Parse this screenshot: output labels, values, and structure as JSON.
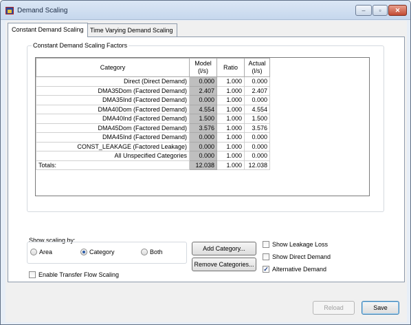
{
  "window": {
    "title": "Demand Scaling",
    "minimize_glyph": "–",
    "restore_glyph": "▫",
    "close_glyph": "✕",
    "icon": "app-icon"
  },
  "tabs": [
    {
      "label": "Constant Demand Scaling",
      "active": true
    },
    {
      "label": "Time Varying Demand Scaling",
      "active": false
    }
  ],
  "factors": {
    "group_title": "Constant Demand Scaling Factors",
    "columns": {
      "category": "Category",
      "model_line1": "Model",
      "model_line2": "(l/s)",
      "ratio": "Ratio",
      "actual_line1": "Actual",
      "actual_line2": "(l/s)"
    },
    "rows": [
      {
        "category": "Direct (Direct Demand)",
        "model": "0.000",
        "ratio": "1.000",
        "actual": "0.000"
      },
      {
        "category": "DMA35Dom (Factored Demand)",
        "model": "2.407",
        "ratio": "1.000",
        "actual": "2.407"
      },
      {
        "category": "DMA35Ind (Factored Demand)",
        "model": "0.000",
        "ratio": "1.000",
        "actual": "0.000"
      },
      {
        "category": "DMA40Dom (Factored Demand)",
        "model": "4.554",
        "ratio": "1.000",
        "actual": "4.554"
      },
      {
        "category": "DMA40Ind (Factored Demand)",
        "model": "1.500",
        "ratio": "1.000",
        "actual": "1.500"
      },
      {
        "category": "DMA45Dom (Factored Demand)",
        "model": "3.576",
        "ratio": "1.000",
        "actual": "3.576"
      },
      {
        "category": "DMA45Ind (Factored Demand)",
        "model": "0.000",
        "ratio": "1.000",
        "actual": "0.000"
      },
      {
        "category": "CONST_LEAKAGE (Factored Leakage)",
        "model": "0.000",
        "ratio": "1.000",
        "actual": "0.000"
      },
      {
        "category": "All Unspecified Categories",
        "model": "0.000",
        "ratio": "1.000",
        "actual": "0.000"
      }
    ],
    "totals": {
      "label": "Totals:",
      "model": "12.038",
      "ratio": "1.000",
      "actual": "12.038"
    }
  },
  "show_scaling": {
    "label": "Show scaling by:",
    "options": [
      {
        "label": "Area",
        "selected": false
      },
      {
        "label": "Category",
        "selected": true
      },
      {
        "label": "Both",
        "selected": false
      }
    ]
  },
  "buttons": {
    "add_category": "Add Category...",
    "remove_categories": "Remove Categories...",
    "reload": "Reload",
    "save": "Save"
  },
  "checkboxes": {
    "show_leakage_loss": {
      "label": "Show Leakage Loss",
      "checked": false
    },
    "show_direct_demand": {
      "label": "Show Direct Demand",
      "checked": false
    },
    "alternative_demand": {
      "label": "Alternative Demand",
      "checked": true
    },
    "enable_transfer_flow": {
      "label": "Enable Transfer Flow Scaling",
      "checked": false
    }
  },
  "check_glyph": "✓"
}
